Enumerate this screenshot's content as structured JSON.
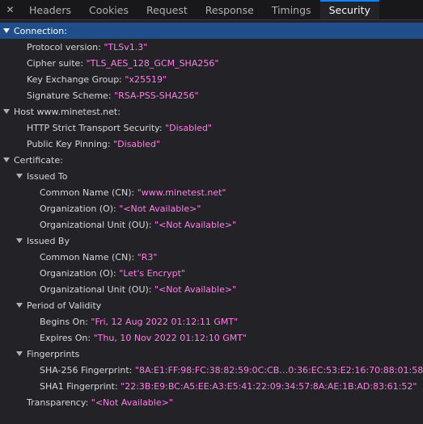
{
  "tabs": {
    "headers": "Headers",
    "cookies": "Cookies",
    "request": "Request",
    "response": "Response",
    "timings": "Timings",
    "security": "Security"
  },
  "connection": {
    "label": "Connection:",
    "protocol_key": "Protocol version:",
    "protocol_val": "\"TLSv1.3\"",
    "cipher_key": "Cipher suite:",
    "cipher_val": "\"TLS_AES_128_GCM_SHA256\"",
    "kex_key": "Key Exchange Group:",
    "kex_val": "\"x25519\"",
    "sig_key": "Signature Scheme:",
    "sig_val": "\"RSA-PSS-SHA256\""
  },
  "host": {
    "label": "Host www.minetest.net:",
    "hsts_key": "HTTP Strict Transport Security:",
    "hsts_val": "\"Disabled\"",
    "hpkp_key": "Public Key Pinning:",
    "hpkp_val": "\"Disabled\""
  },
  "certificate": {
    "label": "Certificate:",
    "issued_to": {
      "label": "Issued To",
      "cn_key": "Common Name (CN):",
      "cn_val": "\"www.minetest.net\"",
      "o_key": "Organization (O):",
      "o_val": "\"<Not Available>\"",
      "ou_key": "Organizational Unit (OU):",
      "ou_val": "\"<Not Available>\""
    },
    "issued_by": {
      "label": "Issued By",
      "cn_key": "Common Name (CN):",
      "cn_val": "\"R3\"",
      "o_key": "Organization (O):",
      "o_val": "\"Let's Encrypt\"",
      "ou_key": "Organizational Unit (OU):",
      "ou_val": "\"<Not Available>\""
    },
    "validity": {
      "label": "Period of Validity",
      "begins_key": "Begins On:",
      "begins_val": "\"Fri, 12 Aug 2022 01:12:11 GMT\"",
      "expires_key": "Expires On:",
      "expires_val": "\"Thu, 10 Nov 2022 01:12:10 GMT\""
    },
    "fingerprints": {
      "label": "Fingerprints",
      "sha256_key": "SHA-256 Fingerprint:",
      "sha256_val": "\"8A:E1:FF:98:FC:38:82:59:0C:CB…0:36:EC:53:E2:16:70:88:01:58\"",
      "sha1_key": "SHA1 Fingerprint:",
      "sha1_val": "\"22:3B:E9:BC:A5:EE:A3:E5:41:22:09:34:57:8A:AE:1B:AD:83:61:52\""
    },
    "transparency_key": "Transparency:",
    "transparency_val": "\"<Not Available>\""
  },
  "colors": {
    "selection": "#204e8a",
    "value": "#ff7de9",
    "tab_accent": "#0a84ff"
  }
}
